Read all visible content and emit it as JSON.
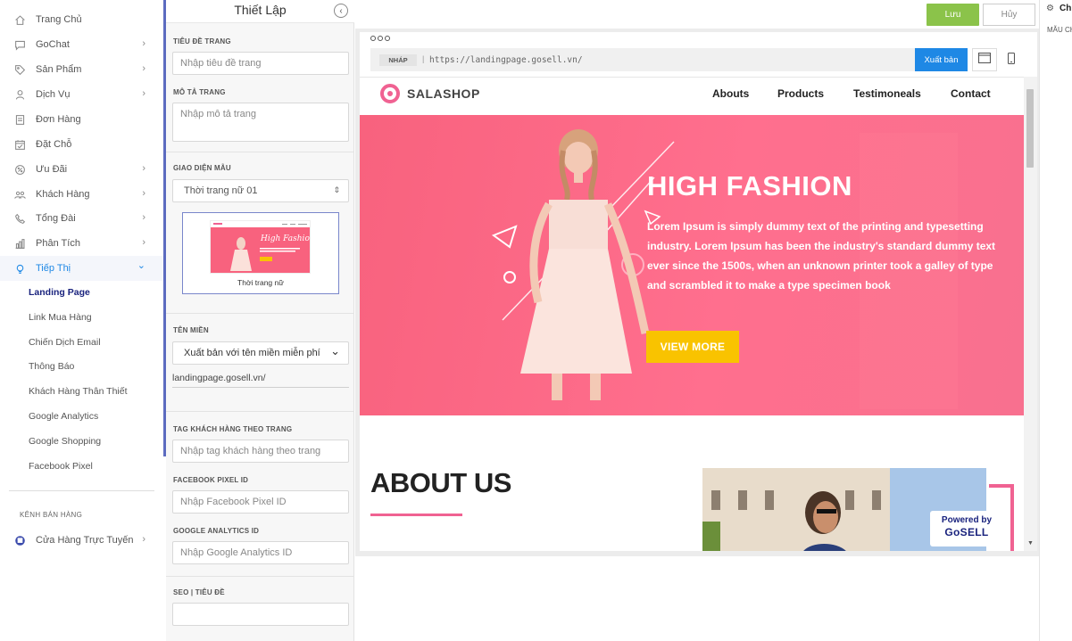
{
  "nav": {
    "items": [
      {
        "label": "Trang Chủ",
        "icon": "home-icon",
        "has_children": false
      },
      {
        "label": "GoChat",
        "icon": "chat-icon",
        "has_children": true
      },
      {
        "label": "Sản Phẩm",
        "icon": "tag-icon",
        "has_children": true
      },
      {
        "label": "Dịch Vụ",
        "icon": "service-icon",
        "has_children": true
      },
      {
        "label": "Đơn Hàng",
        "icon": "order-icon",
        "has_children": false
      },
      {
        "label": "Đặt Chỗ",
        "icon": "calendar-icon",
        "has_children": false
      },
      {
        "label": "Ưu Đãi",
        "icon": "gift-icon",
        "has_children": true
      },
      {
        "label": "Khách Hàng",
        "icon": "customers-icon",
        "has_children": true
      },
      {
        "label": "Tổng Đài",
        "icon": "phone-icon",
        "has_children": true
      },
      {
        "label": "Phân Tích",
        "icon": "analytics-icon",
        "has_children": true
      },
      {
        "label": "Tiếp Thị",
        "icon": "marketing-icon",
        "has_children": true,
        "expanded": true
      }
    ],
    "chevron": "›",
    "chevron_open": "⌄",
    "subitems": [
      {
        "label": "Landing Page",
        "current": true
      },
      {
        "label": "Link Mua Hàng"
      },
      {
        "label": "Chiến Dịch Email"
      },
      {
        "label": "Thông Báo"
      },
      {
        "label": "Khách Hàng Thân Thiết"
      },
      {
        "label": "Google Analytics"
      },
      {
        "label": "Google Shopping"
      },
      {
        "label": "Facebook Pixel"
      }
    ],
    "section_label": "KÊNH BÁN HÀNG",
    "channel": {
      "label": "Cửa Hàng Trực Tuyến",
      "icon": "store-icon"
    }
  },
  "settings": {
    "title": "Thiết Lập",
    "collapse_glyph": "‹",
    "page_title_label": "TIÊU ĐỀ TRANG",
    "page_title_placeholder": "Nhập tiêu đề trang",
    "page_desc_label": "MÔ TẢ TRANG",
    "page_desc_placeholder": "Nhập mô tả trang",
    "template_label": "GIAO DIỆN MẪU",
    "template_value": "Thời trang nữ 01",
    "template_arrow": "⇕",
    "template_caption": "Thời trang nữ",
    "domain_label": "TÊN MIỀN",
    "domain_value": "Xuất bản với tên miền miễn phí",
    "domain_arrow": "⌄",
    "domain_path": "landingpage.gosell.vn/",
    "customer_tag_label": "TAG KHÁCH HÀNG THEO TRANG",
    "customer_tag_placeholder": "Nhập tag khách hàng theo trang",
    "fb_pixel_label": "FACEBOOK PIXEL ID",
    "fb_pixel_placeholder": "Nhập Facebook Pixel ID",
    "ga_label": "GOOGLE ANALYTICS ID",
    "ga_placeholder": "Nhập Google Analytics ID",
    "seo_title_label": "SEO | TIÊU ĐỀ",
    "seo_title_value": ""
  },
  "toolbar": {
    "save_label": "Lưu",
    "cancel_label": "Hủy"
  },
  "right_panel": {
    "tab_label": "Ch",
    "section_label": "MẪU CH"
  },
  "preview": {
    "draft_tag": "NHÁP",
    "url_separator": "|",
    "url": "https://landingpage.gosell.vn/",
    "publish_label": "Xuất bản",
    "site": {
      "brand": "SALASHOP",
      "menu": [
        "Abouts",
        "Products",
        "Testimoneals",
        "Contact"
      ],
      "hero_title": "HIGH FASHION",
      "hero_text": "Lorem Ipsum is simply dummy text of the printing and typesetting industry. Lorem Ipsum has been the industry's standard dummy text ever since the 1500s, when an unknown printer took a galley of type and scrambled it to make a type specimen book",
      "hero_button": "VIEW MORE",
      "about_title": "ABOUT US",
      "powered_line1": "Powered by",
      "powered_line2": "GoSELL"
    },
    "thumb": {
      "title": "High Fashion"
    }
  },
  "colors": {
    "accent_pink": "#f8627e",
    "brand_pink": "#f06292",
    "save_green": "#8bc34a",
    "publish_blue": "#1e88e5",
    "hero_button_yellow": "#f9c300",
    "nav_active_blue": "#1e88e5"
  }
}
